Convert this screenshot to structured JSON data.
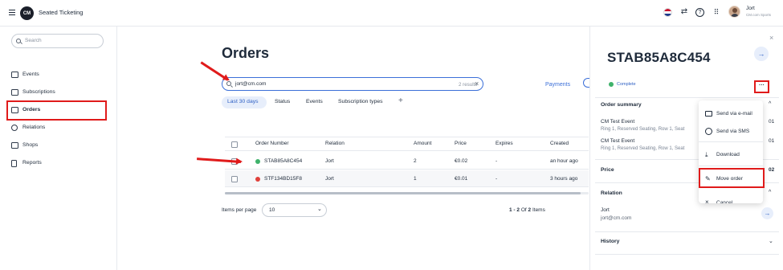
{
  "app": {
    "title": "Seated Ticketing",
    "logo_text": "CM",
    "user_name": "Jort",
    "user_org": "CM.com Sports"
  },
  "sidebar": {
    "search_placeholder": "Search",
    "items": [
      {
        "label": "Events",
        "icon": "calendar-icon"
      },
      {
        "label": "Subscriptions",
        "icon": "card-icon"
      },
      {
        "label": "Orders",
        "icon": "orders-icon",
        "active": true
      },
      {
        "label": "Relations",
        "icon": "people-icon"
      },
      {
        "label": "Shops",
        "icon": "shop-icon"
      },
      {
        "label": "Reports",
        "icon": "report-icon"
      }
    ]
  },
  "main": {
    "title": "Orders",
    "search_value": "jort@cm.com",
    "result_count": "2 results",
    "payments_link": "Payments",
    "filters": [
      "Last 30 days",
      "Status",
      "Events",
      "Subscription types"
    ],
    "table": {
      "columns": [
        "Order Number",
        "Relation",
        "Amount",
        "Price",
        "Expires",
        "Created"
      ],
      "rows": [
        {
          "order": "STAB85A8C454",
          "status": "complete",
          "relation": "Jort",
          "amount": "2",
          "price": "€0.02",
          "expires": "-",
          "created": "an hour ago"
        },
        {
          "order": "STF134BD15F8",
          "status": "error",
          "relation": "Jort",
          "amount": "1",
          "price": "€0.01",
          "expires": "-",
          "created": "3 hours ago"
        }
      ]
    },
    "items_per_page_label": "Items per page",
    "items_per_page_value": "10",
    "pagination": {
      "range": "1 - 2",
      "of": "Of",
      "total": "2",
      "unit": "Items"
    }
  },
  "panel": {
    "order_number": "STAB85A8C454",
    "status": "Complete",
    "order_summary_label": "Order summary",
    "items": [
      {
        "event": "CM Test Event",
        "detail": "Ring 1, Reserved Seating, Row 1, Seat",
        "edge": "01"
      },
      {
        "event": "CM Test Event",
        "detail": "Ring 1, Reserved Seating, Row 1, Seat",
        "edge": "01"
      }
    ],
    "price_label": "Price",
    "price_edge": "02",
    "relation_label": "Relation",
    "relation_name": "Jort",
    "relation_email": "jort@cm.com",
    "history_label": "History"
  },
  "menu": {
    "items": [
      {
        "label": "Send via e-mail",
        "icon": "mail-icon"
      },
      {
        "label": "Send via SMS",
        "icon": "chat-icon"
      },
      {
        "label": "Download",
        "icon": "download-icon"
      },
      {
        "label": "Move order",
        "icon": "pencil-icon"
      },
      {
        "label": "Cancel",
        "icon": "cancel-icon"
      }
    ]
  },
  "colors": {
    "accent": "#3b6fd8",
    "annotation": "#e01b1b",
    "complete": "#3fb26b",
    "error": "#e0413b"
  }
}
